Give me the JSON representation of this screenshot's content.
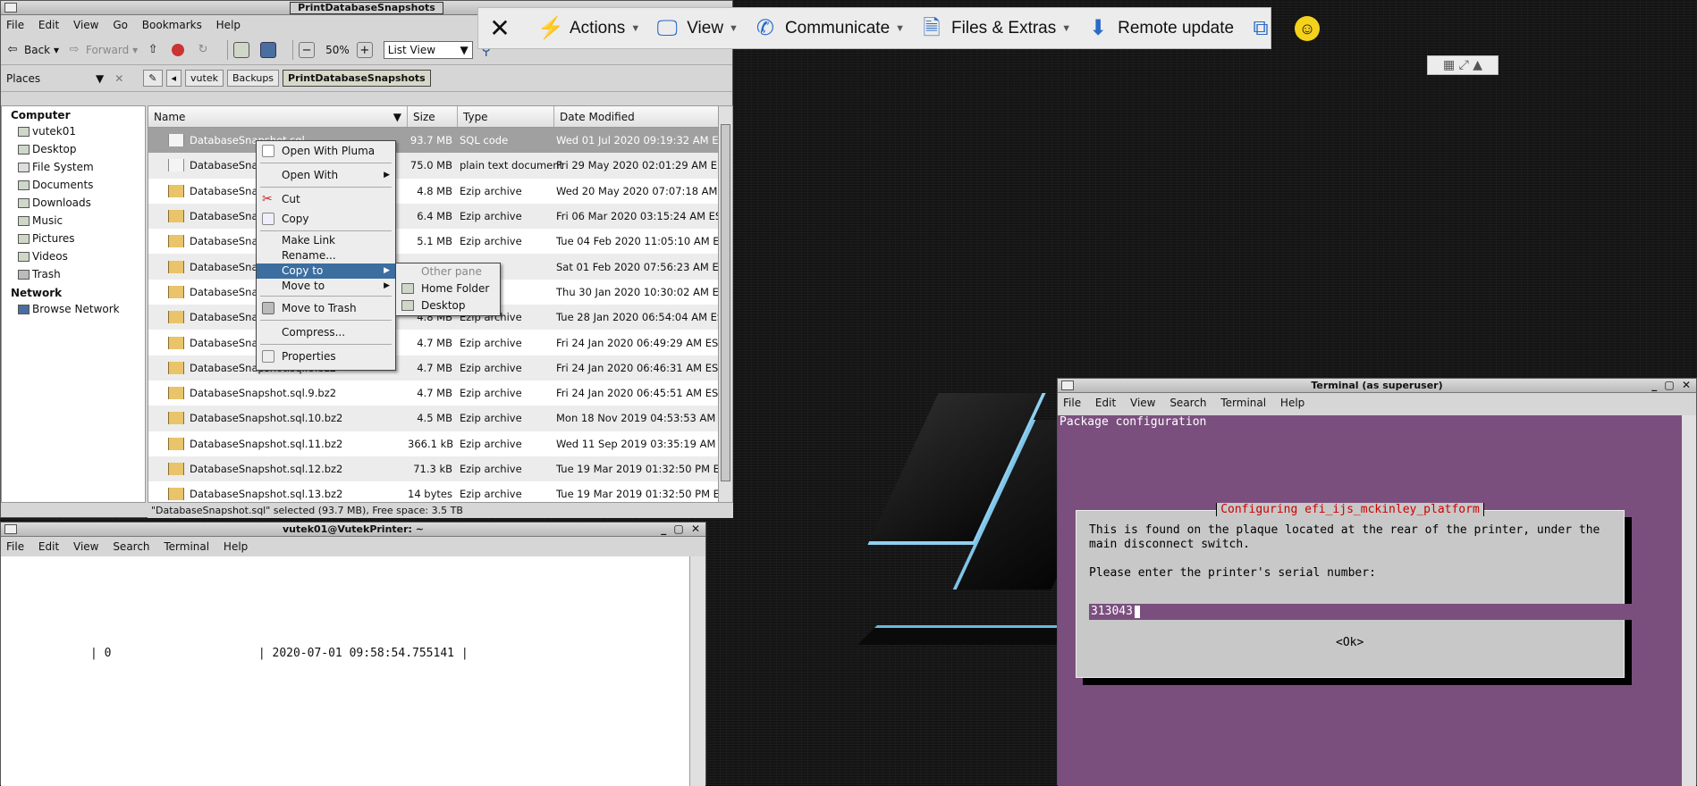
{
  "file_manager": {
    "title": "PrintDatabaseSnapshots",
    "menu": [
      "File",
      "Edit",
      "View",
      "Go",
      "Bookmarks",
      "Help"
    ],
    "toolbar": {
      "back": "Back",
      "forward": "Forward",
      "zoom": "50%",
      "view_mode": "List View"
    },
    "places_label": "Places",
    "breadcrumbs": [
      "vutek",
      "Backups",
      "PrintDatabaseSnapshots"
    ],
    "sidebar": {
      "computer_header": "Computer",
      "items": [
        "vutek01",
        "Desktop",
        "File System",
        "Documents",
        "Downloads",
        "Music",
        "Pictures",
        "Videos",
        "Trash"
      ],
      "network_header": "Network",
      "network_items": [
        "Browse Network"
      ]
    },
    "columns": [
      "Name",
      "Size",
      "Type",
      "Date Modified"
    ],
    "files": [
      {
        "name": "DatabaseSnapshot.sql",
        "size": "93.7 MB",
        "type": "SQL code",
        "date": "Wed 01 Jul 2020 09:19:32 AM EDT"
      },
      {
        "name": "DatabaseSnap",
        "size": "75.0 MB",
        "type": "plain text document",
        "date": "Fri 29 May 2020 02:01:29 AM EDT"
      },
      {
        "name": "DatabaseSnap",
        "size": "4.8 MB",
        "type": "Ezip archive",
        "date": "Wed 20 May 2020 07:07:18 AM EDT"
      },
      {
        "name": "DatabaseSnap",
        "size": "6.4 MB",
        "type": "Ezip archive",
        "date": "Fri 06 Mar 2020 03:15:24 AM EST"
      },
      {
        "name": "DatabaseSnap",
        "size": "5.1 MB",
        "type": "Ezip archive",
        "date": "Tue 04 Feb 2020 11:05:10 AM EST"
      },
      {
        "name": "DatabaseSnap",
        "size": "",
        "type": "ve",
        "date": "Sat 01 Feb 2020 07:56:23 AM EST"
      },
      {
        "name": "DatabaseSnap",
        "size": "",
        "type": "ve",
        "date": "Thu 30 Jan 2020 10:30:02 AM EST"
      },
      {
        "name": "DatabaseSnap",
        "size": "4.8 MB",
        "type": "Ezip archive",
        "date": "Tue 28 Jan 2020 06:54:04 AM EST"
      },
      {
        "name": "DatabaseSnap",
        "size": "4.7 MB",
        "type": "Ezip archive",
        "date": "Fri 24 Jan 2020 06:49:29 AM EST"
      },
      {
        "name": "DatabaseSnapshot.sql.8.bz2",
        "size": "4.7 MB",
        "type": "Ezip archive",
        "date": "Fri 24 Jan 2020 06:46:31 AM EST"
      },
      {
        "name": "DatabaseSnapshot.sql.9.bz2",
        "size": "4.7 MB",
        "type": "Ezip archive",
        "date": "Fri 24 Jan 2020 06:45:51 AM EST"
      },
      {
        "name": "DatabaseSnapshot.sql.10.bz2",
        "size": "4.5 MB",
        "type": "Ezip archive",
        "date": "Mon 18 Nov 2019 04:53:53 AM EST"
      },
      {
        "name": "DatabaseSnapshot.sql.11.bz2",
        "size": "366.1 kB",
        "type": "Ezip archive",
        "date": "Wed 11 Sep 2019 03:35:19 AM EDT"
      },
      {
        "name": "DatabaseSnapshot.sql.12.bz2",
        "size": "71.3 kB",
        "type": "Ezip archive",
        "date": "Tue 19 Mar 2019 01:32:50 PM EDT"
      },
      {
        "name": "DatabaseSnapshot.sql.13.bz2",
        "size": "14 bytes",
        "type": "Ezip archive",
        "date": "Tue 19 Mar 2019 01:32:50 PM EDT"
      }
    ],
    "status": "\"DatabaseSnapshot.sql\" selected (93.7 MB), Free space: 3.5 TB"
  },
  "context_menu": {
    "items": [
      "Open With Pluma",
      "Open With",
      "Cut",
      "Copy",
      "Make Link",
      "Rename...",
      "Copy to",
      "Move to",
      "Move to Trash",
      "Compress...",
      "Properties"
    ],
    "submenu": [
      "Other pane",
      "Home Folder",
      "Desktop"
    ]
  },
  "remote_bar": {
    "actions": "Actions",
    "view": "View",
    "communicate": "Communicate",
    "files": "Files & Extras",
    "remote_update": "Remote update"
  },
  "terminal_user": {
    "title": "vutek01@VutekPrinter: ~",
    "menu": [
      "File",
      "Edit",
      "View",
      "Search",
      "Terminal",
      "Help"
    ],
    "line": "| 0                     | 2020-07-01 09:58:54.755141 |"
  },
  "terminal_root": {
    "title": "Terminal (as superuser)",
    "menu": [
      "File",
      "Edit",
      "View",
      "Search",
      "Terminal",
      "Help"
    ],
    "header": "Package configuration",
    "dialog_title": "Configuring efi_ijs_mckinley_platform",
    "dialog_text": "This is found on the plaque located at the rear of the printer, under the main disconnect switch.",
    "prompt": "Please enter the printer's serial number:",
    "input_value": "313043",
    "ok_label": "<Ok>"
  }
}
